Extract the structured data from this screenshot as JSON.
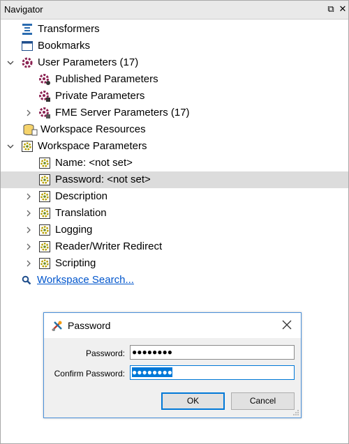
{
  "navigator": {
    "title": "Navigator",
    "restore_glyph": "⧉",
    "close_glyph": "✕"
  },
  "tree": {
    "transformers": "Transformers",
    "bookmarks": "Bookmarks",
    "user_parameters": "User Parameters (17)",
    "published_parameters": "Published Parameters",
    "private_parameters": "Private Parameters",
    "fme_server_parameters": "FME Server Parameters (17)",
    "workspace_resources": "Workspace Resources",
    "workspace_parameters": "Workspace Parameters",
    "name_param": "Name: <not set>",
    "password_param": "Password: <not set>",
    "description": "Description",
    "translation": "Translation",
    "logging": "Logging",
    "reader_writer_redirect": "Reader/Writer Redirect",
    "scripting": "Scripting",
    "workspace_search": "Workspace Search..."
  },
  "dialog": {
    "title": "Password",
    "password_label": "Password:",
    "password_value": "●●●●●●●●",
    "confirm_label": "Confirm Password:",
    "confirm_value": "●●●●●●●●",
    "ok_label": "OK",
    "cancel_label": "Cancel"
  },
  "colors": {
    "link": "#0055cc",
    "selection": "#dcdcdc",
    "accent": "#0078d7"
  }
}
